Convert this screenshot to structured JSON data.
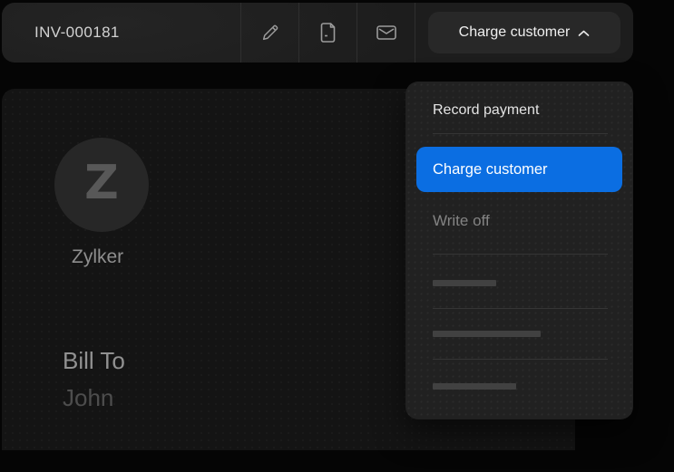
{
  "header": {
    "invoice_number": "INV-000181",
    "icons": [
      "edit-pencil-icon",
      "document-icon",
      "envelope-icon"
    ],
    "charge_button_label": "Charge customer"
  },
  "dropdown": {
    "items": [
      {
        "label": "Record payment",
        "state": "normal"
      },
      {
        "label": "Charge customer",
        "state": "selected"
      },
      {
        "label": "Write off",
        "state": "dimmed"
      }
    ],
    "skeleton_row_count": 3,
    "accent_color": "#0b6ee2"
  },
  "invoice": {
    "logo_letter": "Z",
    "company_name": "Zylker",
    "bill_to_label": "Bill To",
    "customer_name": "John"
  },
  "colors": {
    "page_background": "#050505",
    "toolbar_background": "#1e1e1e",
    "dropdown_background": "#212121",
    "panel_background": "#141414",
    "accent_blue": "#0b6ee2"
  }
}
